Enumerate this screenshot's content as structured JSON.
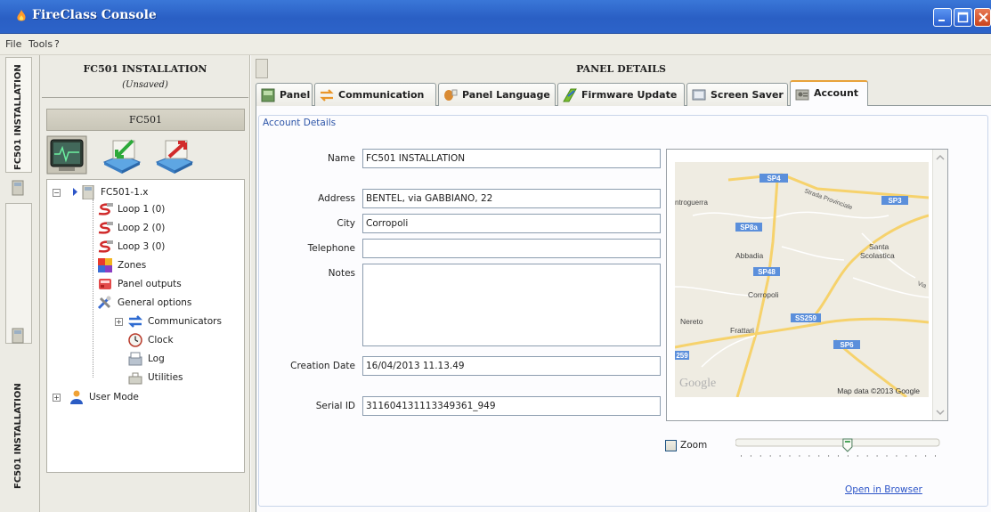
{
  "window": {
    "title": "FireClass Console",
    "accent": "#2b61c8"
  },
  "menu": {
    "items": [
      "File",
      "Tools",
      "?"
    ]
  },
  "side_tabs": {
    "tab1": "FC501 INSTALLATION",
    "tab2": "FC501 INSTALLATION"
  },
  "left_panel": {
    "title": "FC501 INSTALLATION",
    "subtitle": "(Unsaved)",
    "panel_name": "FC501",
    "tree": {
      "root": "FC501-1.x",
      "items": [
        "Loop 1 (0)",
        "Loop 2 (0)",
        "Loop 3 (0)",
        "Zones",
        "Panel outputs",
        "General options",
        "Communicators",
        "Clock",
        "Log",
        "Utilities"
      ],
      "user_mode": "User Mode"
    }
  },
  "right_panel": {
    "title": "PANEL DETAILS",
    "tabs": [
      "Panel",
      "Communication",
      "Panel Language",
      "Firmware Update",
      "Screen Saver",
      "Account"
    ],
    "active_tab": "Account",
    "section": "Account Details",
    "fields": {
      "name": {
        "label": "Name",
        "value": "FC501 INSTALLATION"
      },
      "address": {
        "label": "Address",
        "value": "BENTEL, via GABBIANO, 22"
      },
      "city": {
        "label": "City",
        "value": "Corropoli"
      },
      "telephone": {
        "label": "Telephone",
        "value": ""
      },
      "notes": {
        "label": "Notes",
        "value": ""
      },
      "creation_date": {
        "label": "Creation Date",
        "value": "16/04/2013 11.13.49"
      },
      "serial_id": {
        "label": "Serial ID",
        "value": "311604131113349361_949"
      }
    },
    "map": {
      "labels": {
        "ntroguerra": "ntroguerra",
        "sp4": "SP4",
        "sp3": "SP3",
        "sp8a": "SP8a",
        "strada": "Strada Provinciale",
        "abbadia": "Abbadia",
        "santa": "Santa",
        "scolastica": "Scolastica",
        "sp48": "SP48",
        "corropoli": "Corropoli",
        "via": "Via",
        "nereto": "Nereto",
        "frattari": "Frattari",
        "ss259": "SS259",
        "sp6": "SP6",
        "s259": "259",
        "google": "Google",
        "copyright": "Map data ©2013 Google"
      },
      "zoom_label": "Zoom",
      "zoom_checked": false,
      "zoom_level": 0.55,
      "open_link": "Open in Browser"
    }
  }
}
